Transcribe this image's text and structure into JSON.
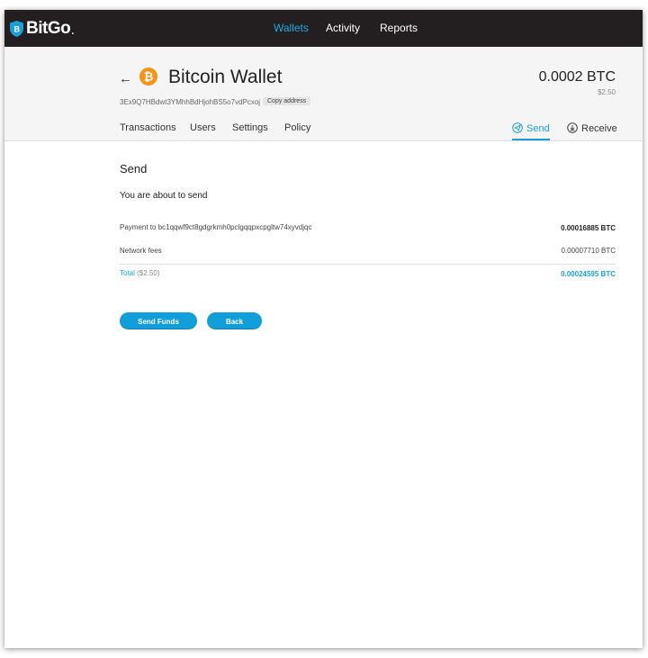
{
  "brand": {
    "name": "BitGo",
    "suffix": "."
  },
  "nav": {
    "items": [
      {
        "label": "Wallets",
        "active": true
      },
      {
        "label": "Activity",
        "active": false
      },
      {
        "label": "Reports",
        "active": false
      }
    ]
  },
  "wallet": {
    "title": "Bitcoin Wallet",
    "balance": "0.0002 BTC",
    "balance_usd": "$2.50",
    "address": "3Ex9Q7HBdwt3YMhhBdHjohBS5o7vdPcxoj",
    "copy_label": "Copy address"
  },
  "tabs": {
    "left": [
      "Transactions",
      "Users",
      "Settings",
      "Policy"
    ],
    "send": "Send",
    "receive": "Receive"
  },
  "send": {
    "title": "Send",
    "subtitle": "You are about to send",
    "payment_label": "Payment to bc1qqwf9ct8gdgrkmh0pclgqqpxcpgltw74xyvdjqc",
    "payment_value": "0.00016885 BTC",
    "fees_label": "Network fees",
    "fees_value": "0.00007710 BTC",
    "total_label": "Total",
    "total_usd": "($2.50)",
    "total_value": "0.00024595 BTC",
    "send_button": "Send Funds",
    "back_button": "Back"
  },
  "colors": {
    "accent": "#1b9fd6",
    "topbar": "#231f20",
    "bitcoin": "#f7931a"
  }
}
